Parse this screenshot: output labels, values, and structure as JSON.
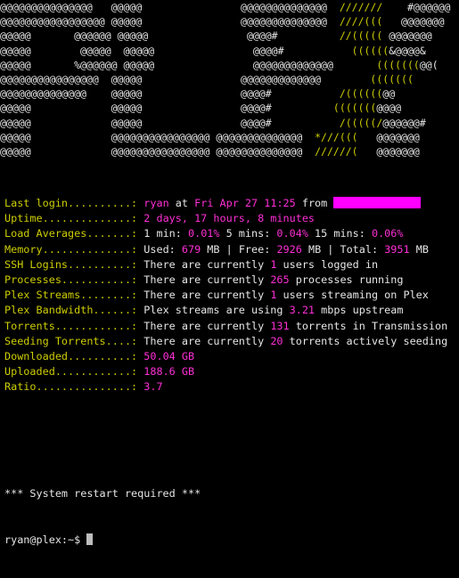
{
  "terminal": {
    "background_color": "#000000",
    "label_color": "#cdcd00",
    "value_color": "#ff2fd6",
    "text_color": "#e6e6e6",
    "ascii_at_color": "#e8e8e8",
    "ascii_accent_color": "#cdcd00"
  },
  "banner": {
    "description": "ASCII art spelling PLEX",
    "lines": [
      [
        {
          "t": "@@@@@@@@@@@@@@@",
          "c": "at"
        },
        {
          "t": "   @@@@@",
          "c": "at"
        },
        {
          "t": "                @@@@@@@@@@@@@@",
          "c": "at"
        },
        {
          "t": "  ///////",
          "c": "yel"
        },
        {
          "t": "    #@@@@@@",
          "c": "at"
        }
      ],
      [
        {
          "t": "@@@@@@@@@@@@@@@@@",
          "c": "at"
        },
        {
          "t": " @@@@@",
          "c": "at"
        },
        {
          "t": "                @@@@@@@@@@@@@@",
          "c": "at"
        },
        {
          "t": "  ////(((",
          "c": "yel"
        },
        {
          "t": "   @@@@@@@",
          "c": "at"
        }
      ],
      [
        {
          "t": "@@@@@",
          "c": "at"
        },
        {
          "t": "       @@@@@@",
          "c": "at"
        },
        {
          "t": " @@@@@",
          "c": "at"
        },
        {
          "t": "                @@@@#",
          "c": "at"
        },
        {
          "t": "          //(((((",
          "c": "yel"
        },
        {
          "t": " @@@@@@@",
          "c": "at"
        }
      ],
      [
        {
          "t": "@@@@@",
          "c": "at"
        },
        {
          "t": "        @@@@@",
          "c": "at"
        },
        {
          "t": "  @@@@@",
          "c": "at"
        },
        {
          "t": "                @@@@#",
          "c": "at"
        },
        {
          "t": "           ((((((",
          "c": "yel"
        },
        {
          "t": "&@@@@&",
          "c": "at"
        }
      ],
      [
        {
          "t": "@@@@@",
          "c": "at"
        },
        {
          "t": "       %@@@@@@",
          "c": "at"
        },
        {
          "t": " @@@@@",
          "c": "at"
        },
        {
          "t": "                @@@@@@@@@@@@@",
          "c": "at"
        },
        {
          "t": "       (((((((",
          "c": "yel"
        },
        {
          "t": "@@(",
          "c": "at"
        }
      ],
      [
        {
          "t": "@@@@@@@@@@@@@@@@",
          "c": "at"
        },
        {
          "t": "  @@@@@",
          "c": "at"
        },
        {
          "t": "                @@@@@@@@@@@@@",
          "c": "at"
        },
        {
          "t": "        (((((((",
          "c": "yel"
        }
      ],
      [
        {
          "t": "@@@@@@@@@@@@@@",
          "c": "at"
        },
        {
          "t": "    @@@@@",
          "c": "at"
        },
        {
          "t": "                @@@@#",
          "c": "at"
        },
        {
          "t": "           /((((((",
          "c": "yel"
        },
        {
          "t": "@@",
          "c": "at"
        }
      ],
      [
        {
          "t": "@@@@@",
          "c": "at"
        },
        {
          "t": "             @@@@@",
          "c": "at"
        },
        {
          "t": "                @@@@#",
          "c": "at"
        },
        {
          "t": "          (((((((",
          "c": "yel"
        },
        {
          "t": "@@@@",
          "c": "at"
        }
      ],
      [
        {
          "t": "@@@@@",
          "c": "at"
        },
        {
          "t": "             @@@@@",
          "c": "at"
        },
        {
          "t": "                @@@@#",
          "c": "at"
        },
        {
          "t": "           /(((((/",
          "c": "yel"
        },
        {
          "t": "@@@@@@#",
          "c": "at"
        }
      ],
      [
        {
          "t": "@@@@@",
          "c": "at"
        },
        {
          "t": "             @@@@@@@@@@@@@@@@",
          "c": "at"
        },
        {
          "t": " @@@@@@@@@@@@@@",
          "c": "at"
        },
        {
          "t": "  *///(((",
          "c": "yel"
        },
        {
          "t": "   @@@@@@@",
          "c": "at"
        }
      ],
      [
        {
          "t": "@@@@@",
          "c": "at"
        },
        {
          "t": "             @@@@@@@@@@@@@@@@",
          "c": "at"
        },
        {
          "t": " @@@@@@@@@@@@@@",
          "c": "at"
        },
        {
          "t": "  //////(",
          "c": "yel"
        },
        {
          "t": "   @@@@@@@",
          "c": "at"
        }
      ]
    ]
  },
  "info": {
    "rows": [
      {
        "label": "Last login..........: ",
        "segments": [
          {
            "t": "ryan",
            "c": "val"
          },
          {
            "t": " at ",
            "c": "txt"
          },
          {
            "t": "Fri Apr 27 11:25",
            "c": "val"
          },
          {
            "t": " from ",
            "c": "txt"
          },
          {
            "t": "",
            "c": "redact"
          }
        ]
      },
      {
        "label": "Uptime..............: ",
        "segments": [
          {
            "t": "2 days, 17 hours, 8 minutes",
            "c": "val"
          }
        ]
      },
      {
        "label": "Load Averages.......: ",
        "segments": [
          {
            "t": "1 min: ",
            "c": "txt"
          },
          {
            "t": "0.01%",
            "c": "val"
          },
          {
            "t": " 5 mins: ",
            "c": "txt"
          },
          {
            "t": "0.04%",
            "c": "val"
          },
          {
            "t": " 15 mins: ",
            "c": "txt"
          },
          {
            "t": "0.06%",
            "c": "val"
          }
        ]
      },
      {
        "label": "Memory..............: ",
        "segments": [
          {
            "t": "Used: ",
            "c": "txt"
          },
          {
            "t": "679",
            "c": "val"
          },
          {
            "t": " MB | Free: ",
            "c": "txt"
          },
          {
            "t": "2926",
            "c": "val"
          },
          {
            "t": " MB | Total: ",
            "c": "txt"
          },
          {
            "t": "3951",
            "c": "val"
          },
          {
            "t": " MB",
            "c": "txt"
          }
        ]
      },
      {
        "label": "SSH Logins..........: ",
        "segments": [
          {
            "t": "There are currently ",
            "c": "txt"
          },
          {
            "t": "1",
            "c": "val"
          },
          {
            "t": " users logged in",
            "c": "txt"
          }
        ]
      },
      {
        "label": "Processes...........: ",
        "segments": [
          {
            "t": "There are currently ",
            "c": "txt"
          },
          {
            "t": "265",
            "c": "val"
          },
          {
            "t": " processes running",
            "c": "txt"
          }
        ]
      },
      {
        "label": "Plex Streams........: ",
        "segments": [
          {
            "t": "There are currently ",
            "c": "txt"
          },
          {
            "t": "1",
            "c": "val"
          },
          {
            "t": " users streaming on Plex",
            "c": "txt"
          }
        ]
      },
      {
        "label": "Plex Bandwidth......: ",
        "segments": [
          {
            "t": "Plex streams are using ",
            "c": "txt"
          },
          {
            "t": "3.21",
            "c": "val"
          },
          {
            "t": " mbps upstream",
            "c": "txt"
          }
        ]
      },
      {
        "label": "Torrents............: ",
        "segments": [
          {
            "t": "There are currently ",
            "c": "txt"
          },
          {
            "t": "131",
            "c": "val"
          },
          {
            "t": " torrents in Transmission",
            "c": "txt"
          }
        ]
      },
      {
        "label": "Seeding Torrents....: ",
        "segments": [
          {
            "t": "There are currently ",
            "c": "txt"
          },
          {
            "t": "20",
            "c": "val"
          },
          {
            "t": " torrents actively seeding",
            "c": "txt"
          }
        ]
      },
      {
        "label": "Downloaded..........: ",
        "segments": [
          {
            "t": "50.04 GB",
            "c": "val"
          }
        ]
      },
      {
        "label": "Uploaded............: ",
        "segments": [
          {
            "t": "188.6 GB",
            "c": "val"
          }
        ]
      },
      {
        "label": "Ratio...............: ",
        "segments": [
          {
            "t": "3.7",
            "c": "val"
          }
        ]
      }
    ]
  },
  "footer": {
    "restart_notice": "*** System restart required ***",
    "prompt": "ryan@plex:~$ "
  }
}
